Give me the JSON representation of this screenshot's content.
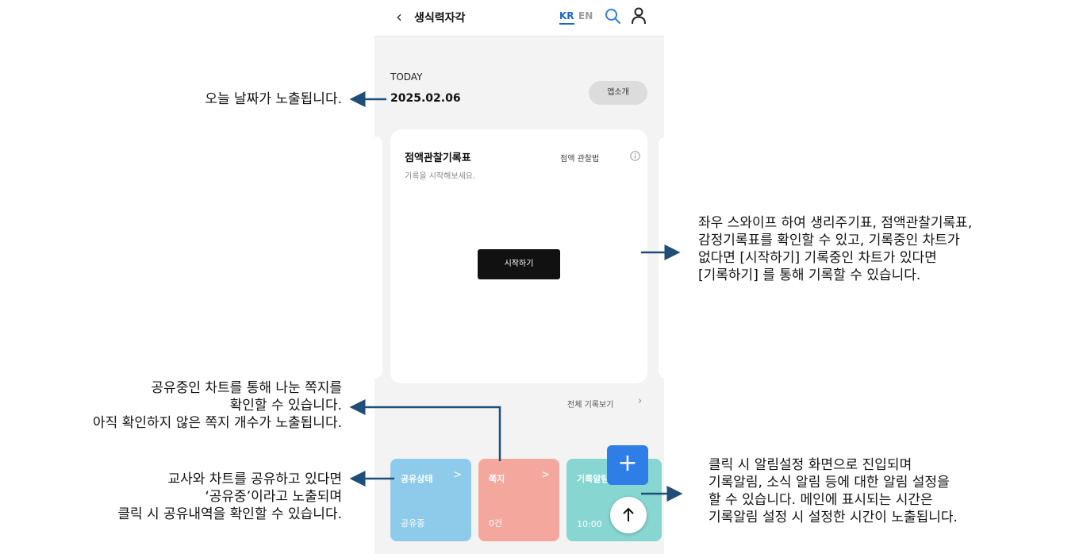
{
  "header": {
    "back_label": "‹",
    "title": "생식력자각",
    "lang_kr": "KR",
    "lang_en": "EN",
    "search_icon": "search-icon",
    "user_icon": "user-icon"
  },
  "today": {
    "label": "TODAY",
    "date": "2025.02.06",
    "app_intro_label": "앱소개"
  },
  "card": {
    "title": "점액관찰기록표",
    "subtitle": "기록을 시작해보세요.",
    "guide_label": "점액 관찰법",
    "start_label": "시작하기"
  },
  "view_all_label": "전체 기록보기",
  "tiles": [
    {
      "title": "공유상태",
      "chevron": ">",
      "value": "공유중",
      "color": "#8ecbea"
    },
    {
      "title": "쪽지",
      "chevron": ">",
      "value": "0건",
      "color": "#f4a79d"
    },
    {
      "title": "기록알림",
      "value": "10:00",
      "color": "#87d6d2"
    }
  ],
  "fab": {
    "add_label": "+",
    "top_icon": "arrow-up-icon"
  },
  "annotations": {
    "date": "오늘 날짜가 노출됩니다.",
    "swipe": [
      "좌우 스와이프 하여 생리주기표, 점액관찰기록표,",
      "감정기록표를 확인할 수 있고, 기록중인 차트가",
      "없다면 [시작하기]  기록중인 차트가 있다면",
      "[기록하기] 를 통해 기록할 수 있습니다."
    ],
    "note": [
      "공유중인 차트를 통해 나눈 쪽지를",
      "확인할 수 있습니다.",
      "아직 확인하지 않은 쪽지 개수가 노출됩니다."
    ],
    "share": [
      "교사와 차트를 공유하고 있다면",
      "‘공유중’이라고 노출되며",
      "클릭 시 공유내역을 확인할 수 있습니다."
    ],
    "alarm": [
      "클릭 시 알림설정 화면으로 진입되며",
      "기록알림, 소식 알림 등에 대한 알림 설정을",
      "할 수 있습니다. 메인에 표시되는 시간은",
      "기록알림 설정 시 설정한 시간이 노출됩니다."
    ]
  },
  "colors": {
    "accent": "#1a66c9",
    "fab": "#2f7de6",
    "arrow": "#1f4e79"
  }
}
